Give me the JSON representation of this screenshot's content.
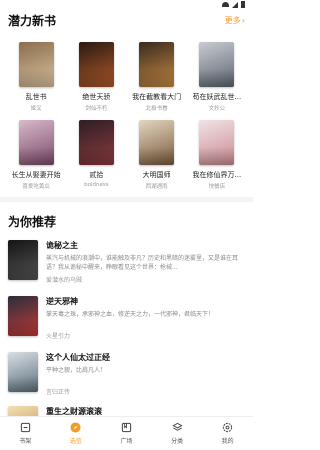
{
  "colors": {
    "accent": "#f59a23",
    "text": "#111111",
    "muted": "#9a9a9a"
  },
  "section_new": {
    "title": "潜力新书",
    "more_label": "更多",
    "books": [
      {
        "title": "乱世书",
        "author": "姬叉",
        "cover": [
          "#8a6d4d",
          "#d8c2a0"
        ]
      },
      {
        "title": "绝世天骄",
        "author": "剑仙不朽",
        "cover": [
          "#2a1a12",
          "#b05a2a"
        ]
      },
      {
        "title": "我在截教看大门",
        "author": "北极书眷",
        "cover": [
          "#3a2a1e",
          "#c68a43"
        ]
      },
      {
        "title": "苟在妖武乱世...",
        "author": "文抄公",
        "cover": [
          "#c9ccd1",
          "#5c6470"
        ]
      },
      {
        "title": "长生从娶妻开始",
        "author": "喜爱吃黄瓜",
        "cover": [
          "#d7b9c9",
          "#7b4a6a"
        ]
      },
      {
        "title": "贰拾",
        "author": "boldness",
        "cover": [
          "#2c1f24",
          "#8e3b3f"
        ]
      },
      {
        "title": "大明国师",
        "author": "西湖遇雨",
        "cover": [
          "#e2d6c0",
          "#7a5a3c"
        ]
      },
      {
        "title": "我在修仙界万...",
        "author": "快餐店",
        "cover": [
          "#f1e3e4",
          "#c98a92"
        ]
      }
    ]
  },
  "section_rec": {
    "title": "为你推荐",
    "items": [
      {
        "title": "诡秘之主",
        "desc": "蒸汽与机械的浪潮中，谁能触及非凡？历史和黑暗的迷雾里，又是谁在耳语？我从诡秘中醒来，睁眼看见这个世界：枪械...",
        "author": "爱潜水的乌贼",
        "cover": [
          "#141414",
          "#555555"
        ]
      },
      {
        "title": "逆天邪神",
        "desc": "掌天毒之珠，承邪神之血，修逆天之力，一代邪神，君临天下！",
        "author": "火星引力",
        "cover": [
          "#2a2e3a",
          "#c23a3a"
        ]
      },
      {
        "title": "这个人仙太过正经",
        "desc": "平种之貌，比肩凡人！",
        "author": "言归正传",
        "cover": [
          "#d9dfe3",
          "#5a6f7d"
        ]
      },
      {
        "title": "重生之财源滚滚",
        "desc": "",
        "author": "",
        "cover": [
          "#f3e0b8",
          "#b98a3a"
        ]
      }
    ]
  },
  "tabs": [
    {
      "label": "书架",
      "icon": "bookshelf-icon",
      "active": false
    },
    {
      "label": "选信",
      "icon": "compass-icon",
      "active": true
    },
    {
      "label": "广场",
      "icon": "book-open-icon",
      "active": false
    },
    {
      "label": "分类",
      "icon": "layers-icon",
      "active": false
    },
    {
      "label": "我的",
      "icon": "gear-icon",
      "active": false
    }
  ]
}
